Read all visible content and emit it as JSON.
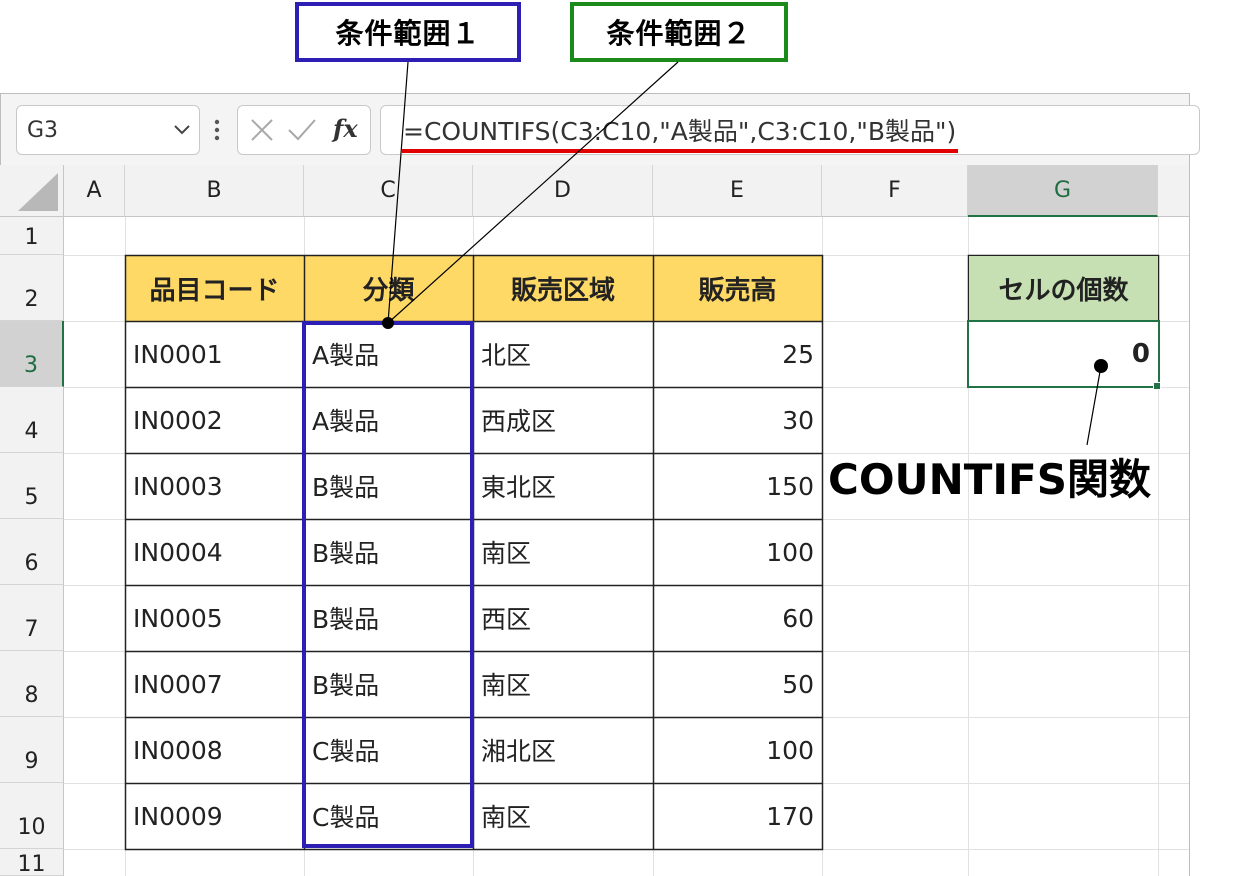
{
  "callouts": {
    "range1": "条件範囲１",
    "range2": "条件範囲２",
    "function_label": "COUNTIFS関数"
  },
  "formula_bar": {
    "name_box": "G3",
    "formula": "=COUNTIFS(C3:C10,\"A製品\",C3:C10,\"B製品\")"
  },
  "columns": [
    "A",
    "B",
    "C",
    "D",
    "E",
    "F",
    "G"
  ],
  "rows": [
    "1",
    "2",
    "3",
    "4",
    "5",
    "6",
    "7",
    "8",
    "9",
    "10",
    "11"
  ],
  "table": {
    "headers": [
      "品目コード",
      "分類",
      "販売区域",
      "販売高"
    ],
    "data": [
      [
        "IN0001",
        "A製品",
        "北区",
        "25"
      ],
      [
        "IN0002",
        "A製品",
        "西成区",
        "30"
      ],
      [
        "IN0003",
        "B製品",
        "東北区",
        "150"
      ],
      [
        "IN0004",
        "B製品",
        "南区",
        "100"
      ],
      [
        "IN0005",
        "B製品",
        "西区",
        "60"
      ],
      [
        "IN0007",
        "B製品",
        "南区",
        "50"
      ],
      [
        "IN0008",
        "C製品",
        "湘北区",
        "100"
      ],
      [
        "IN0009",
        "C製品",
        "南区",
        "170"
      ]
    ]
  },
  "result": {
    "header": "セルの個数",
    "value": "0"
  },
  "colors": {
    "header_fill": "#ffd966",
    "result_header_fill": "#c6e0b4",
    "range1_border": "#2e1fb4",
    "range2_border": "#1a8a1a",
    "formula_underline": "#e00000",
    "active_cell": "#217346"
  },
  "icons": [
    "chevron-down-icon",
    "more-vertical-icon",
    "cancel-x-icon",
    "check-icon",
    "fx-icon"
  ]
}
